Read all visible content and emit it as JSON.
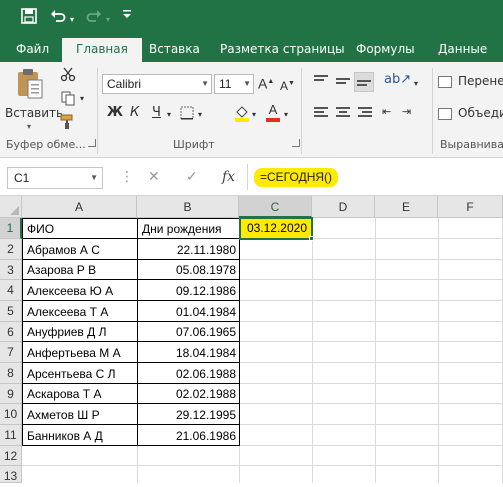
{
  "qat": {
    "save_icon": "save-icon",
    "undo_icon": "undo-icon",
    "redo_icon": "redo-icon",
    "customize_icon": "customize-qat-icon"
  },
  "tabs": [
    "Файл",
    "Главная",
    "Вставка",
    "Разметка страницы",
    "Формулы",
    "Данные"
  ],
  "active_tab": "Главная",
  "ribbon": {
    "paste_label": "Вставить",
    "clipboard_group": "Буфер обме...",
    "font_group": "Шрифт",
    "alignment_group": "Выравниван",
    "font_name": "Calibri",
    "font_size": "11",
    "bold": "Ж",
    "italic": "К",
    "underline": "Ч",
    "font_color_glyph": "А",
    "wrap_label": "Перенес",
    "merge_label": "Объедин"
  },
  "formula_bar": {
    "name_box": "C1",
    "cancel": "✕",
    "enter": "✓",
    "fx": "fx",
    "formula": "=СЕГОДНЯ()"
  },
  "grid": {
    "columns": [
      "A",
      "B",
      "C",
      "D",
      "E",
      "F"
    ],
    "rows": [
      "1",
      "2",
      "3",
      "4",
      "5",
      "6",
      "7",
      "8",
      "9",
      "10",
      "11",
      "12",
      "13"
    ],
    "selected_cell": "C1",
    "selected_value": "03.12.2020",
    "header_fio": "ФИО",
    "header_birthdays": "Дни рождения",
    "records": [
      {
        "name": "Абрамов А С",
        "date": "22.11.1980"
      },
      {
        "name": "Азарова Р В",
        "date": "05.08.1978"
      },
      {
        "name": "Алексеева Ю А",
        "date": "09.12.1986"
      },
      {
        "name": "Алексеева Т А",
        "date": "01.04.1984"
      },
      {
        "name": "Ануфриев Д Л",
        "date": "07.06.1965"
      },
      {
        "name": "Анфертьева М А",
        "date": "18.04.1984"
      },
      {
        "name": "Арсентьева С Л",
        "date": "02.06.1988"
      },
      {
        "name": "Аскарова Т А",
        "date": "02.02.1988"
      },
      {
        "name": "Ахметов Ш Р",
        "date": "29.12.1995"
      },
      {
        "name": "Банников А Д",
        "date": "21.06.1986"
      }
    ]
  },
  "colors": {
    "excel_green": "#217346",
    "highlight_yellow": "#ffea00"
  }
}
